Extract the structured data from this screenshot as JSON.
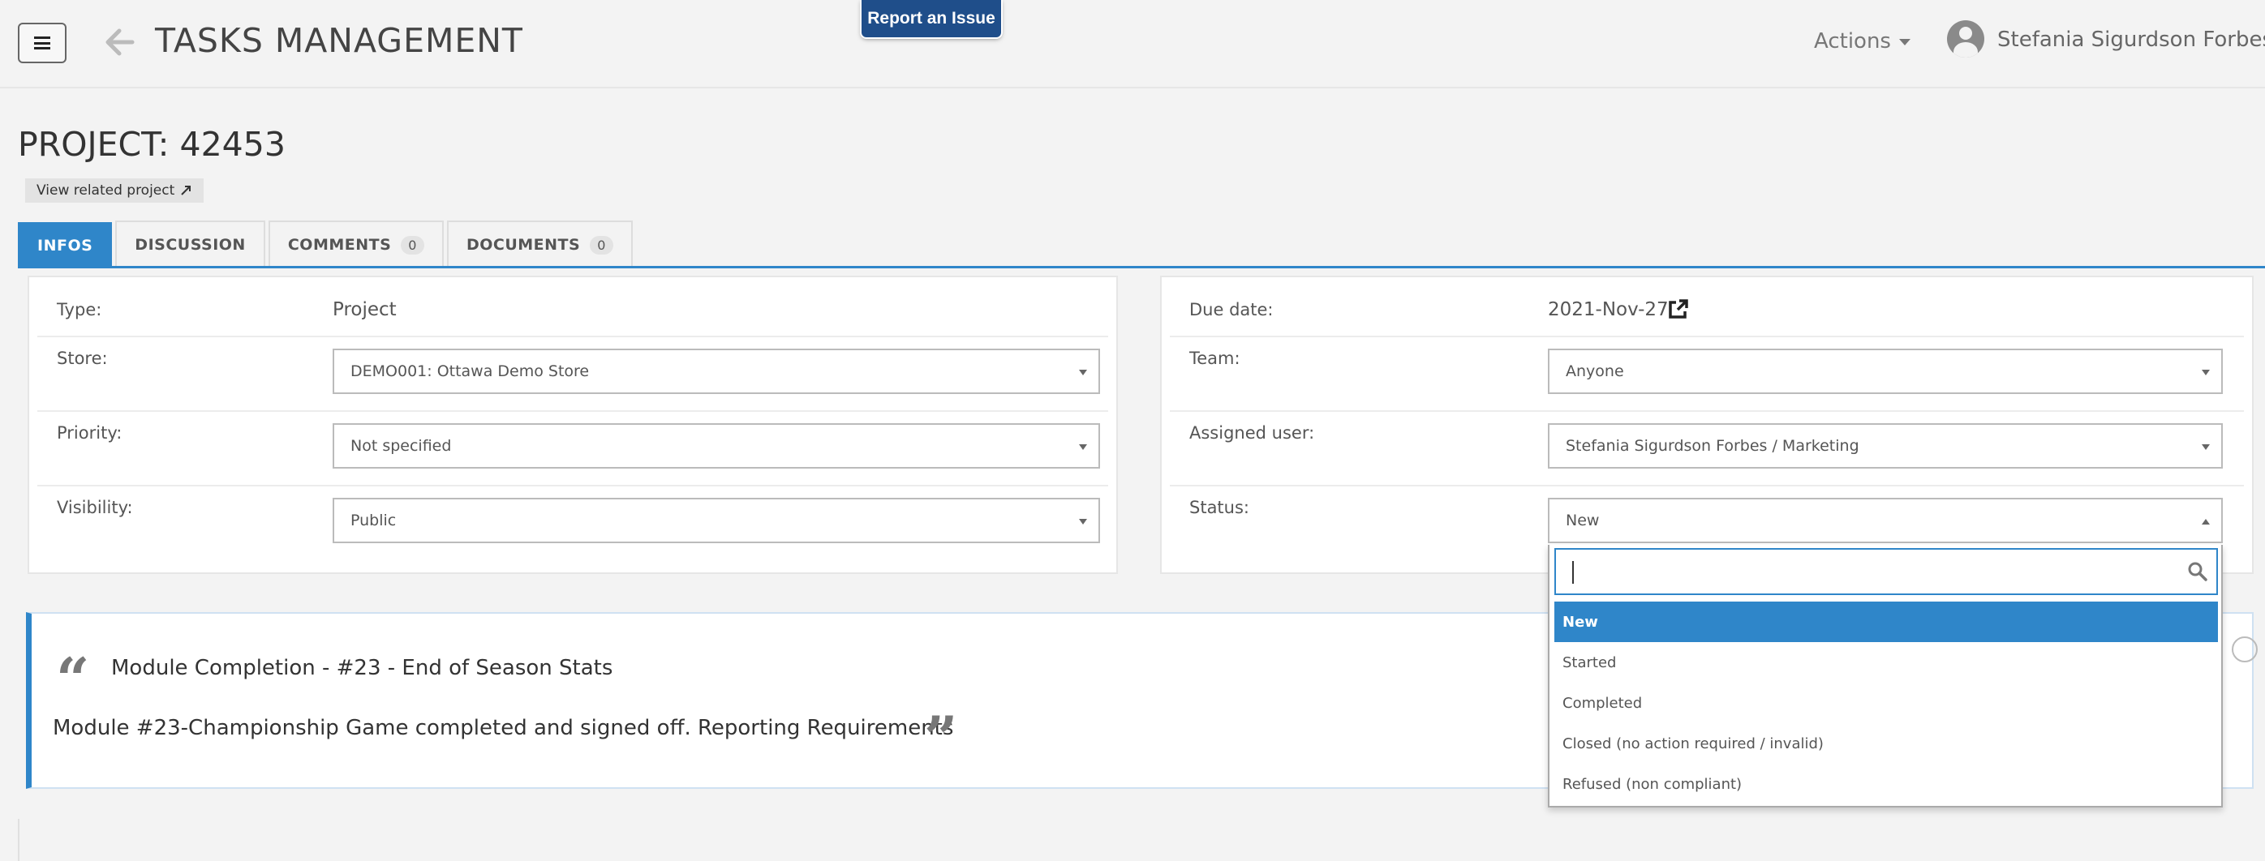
{
  "header": {
    "title": "TASKS MANAGEMENT",
    "report_button": "Report an Issue",
    "actions_label": "Actions",
    "user_name": "Stefania Sigurdson Forbes"
  },
  "project": {
    "title": "PROJECT: 42453",
    "related_link": "View related project"
  },
  "tabs": [
    {
      "label": "INFOS",
      "active": true
    },
    {
      "label": "DISCUSSION"
    },
    {
      "label": "COMMENTS",
      "count": "0"
    },
    {
      "label": "DOCUMENTS",
      "count": "0"
    }
  ],
  "left_panel": {
    "type_label": "Type:",
    "type_value": "Project",
    "store_label": "Store:",
    "store_value": "DEMO001: Ottawa Demo Store",
    "priority_label": "Priority:",
    "priority_value": "Not specified",
    "visibility_label": "Visibility:",
    "visibility_value": "Public"
  },
  "right_panel": {
    "due_label": "Due date:",
    "due_value": "2021-Nov-27",
    "team_label": "Team:",
    "team_value": "Anyone",
    "assigned_label": "Assigned user:",
    "assigned_value": "Stefania Sigurdson Forbes / Marketing",
    "status_label": "Status:",
    "status_value": "New"
  },
  "status_dropdown": {
    "search_value": "",
    "options": [
      "New",
      "Started",
      "Completed",
      "Closed (no action required / invalid)",
      "Refused (non compliant)"
    ],
    "selected": "New"
  },
  "description": {
    "title": "Module Completion - #23 - End of Season Stats",
    "body": "Module #23-Championship Game completed and signed off. Reporting Requirements"
  },
  "colors": {
    "accent": "#2f86c9",
    "report_button": "#1f4e8a"
  }
}
